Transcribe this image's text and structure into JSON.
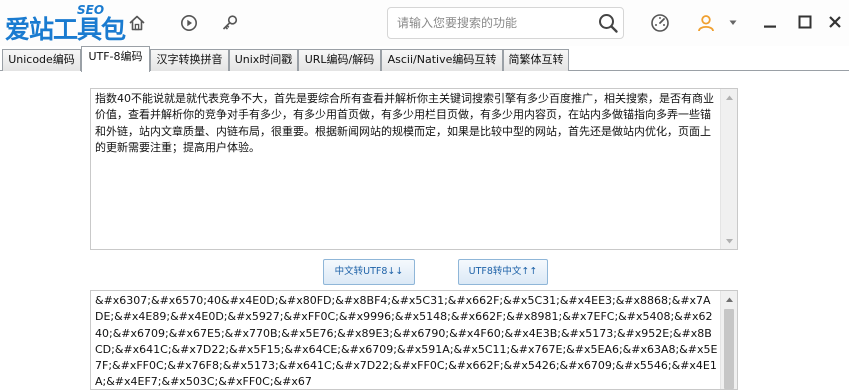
{
  "logo": {
    "main": "爱站工具包",
    "seo": "SEO"
  },
  "search": {
    "placeholder": "请输入您要搜索的功能"
  },
  "tabs": [
    {
      "label": "Unicode编码",
      "active": false
    },
    {
      "label": "UTF-8编码",
      "active": true
    },
    {
      "label": "汉字转换拼音",
      "active": false
    },
    {
      "label": "Unix时间戳",
      "active": false
    },
    {
      "label": "URL编码/解码",
      "active": false
    },
    {
      "label": "Ascii/Native编码互转",
      "active": false
    },
    {
      "label": "简繁体互转",
      "active": false
    }
  ],
  "input_text": "指数40不能说就是就代表竞争不大，首先是要综合所有查看并解析你主关键词搜索引擎有多少百度推广，相关搜索，是否有商业价值，查看并解析你的竞争对手有多少，有多少用首页做，有多少用栏目页做，有多少用内容页，在站内多做锚指向多弄一些锚和外链，站内文章质量、内链布局，很重要。根据新闻网站的规模而定，如果是比较中型的网站，首先还是做站内优化，页面上的更新需要注重；提高用户体验。",
  "buttons": {
    "to_utf8": "中文转UTF8↓↓",
    "to_chinese": "UTF8转中文↑↑"
  },
  "output_text": "&#x6307;&#x6570;40&#x4E0D;&#x80FD;&#x8BF4;&#x5C31;&#x662F;&#x5C31;&#x4EE3;&#x8868;&#x7ADE;&#x4E89;&#x4E0D;&#x5927;&#xFF0C;&#x9996;&#x5148;&#x662F;&#x8981;&#x7EFC;&#x5408;&#x6240;&#x6709;&#x67E5;&#x770B;&#x5E76;&#x89E3;&#x6790;&#x4F60;&#x4E3B;&#x5173;&#x952E;&#x8BCD;&#x641C;&#x7D22;&#x5F15;&#x64CE;&#x6709;&#x591A;&#x5C11;&#x767E;&#x5EA6;&#x63A8;&#x5E7F;&#xFF0C;&#x76F8;&#x5173;&#x641C;&#x7D22;&#xFF0C;&#x662F;&#x5426;&#x6709;&#x5546;&#x4E1A;&#x4EF7;&#x503C;&#xFF0C;&#x67",
  "colors": {
    "accent": "#1a7bd0",
    "button_text": "#1e62a8",
    "avatar": "#f0a030"
  },
  "icons": [
    "home-icon",
    "play-icon",
    "key-icon",
    "search-icon",
    "dashboard-icon",
    "user-icon",
    "chevron-down-icon",
    "minimize-icon",
    "maximize-icon",
    "close-icon"
  ]
}
